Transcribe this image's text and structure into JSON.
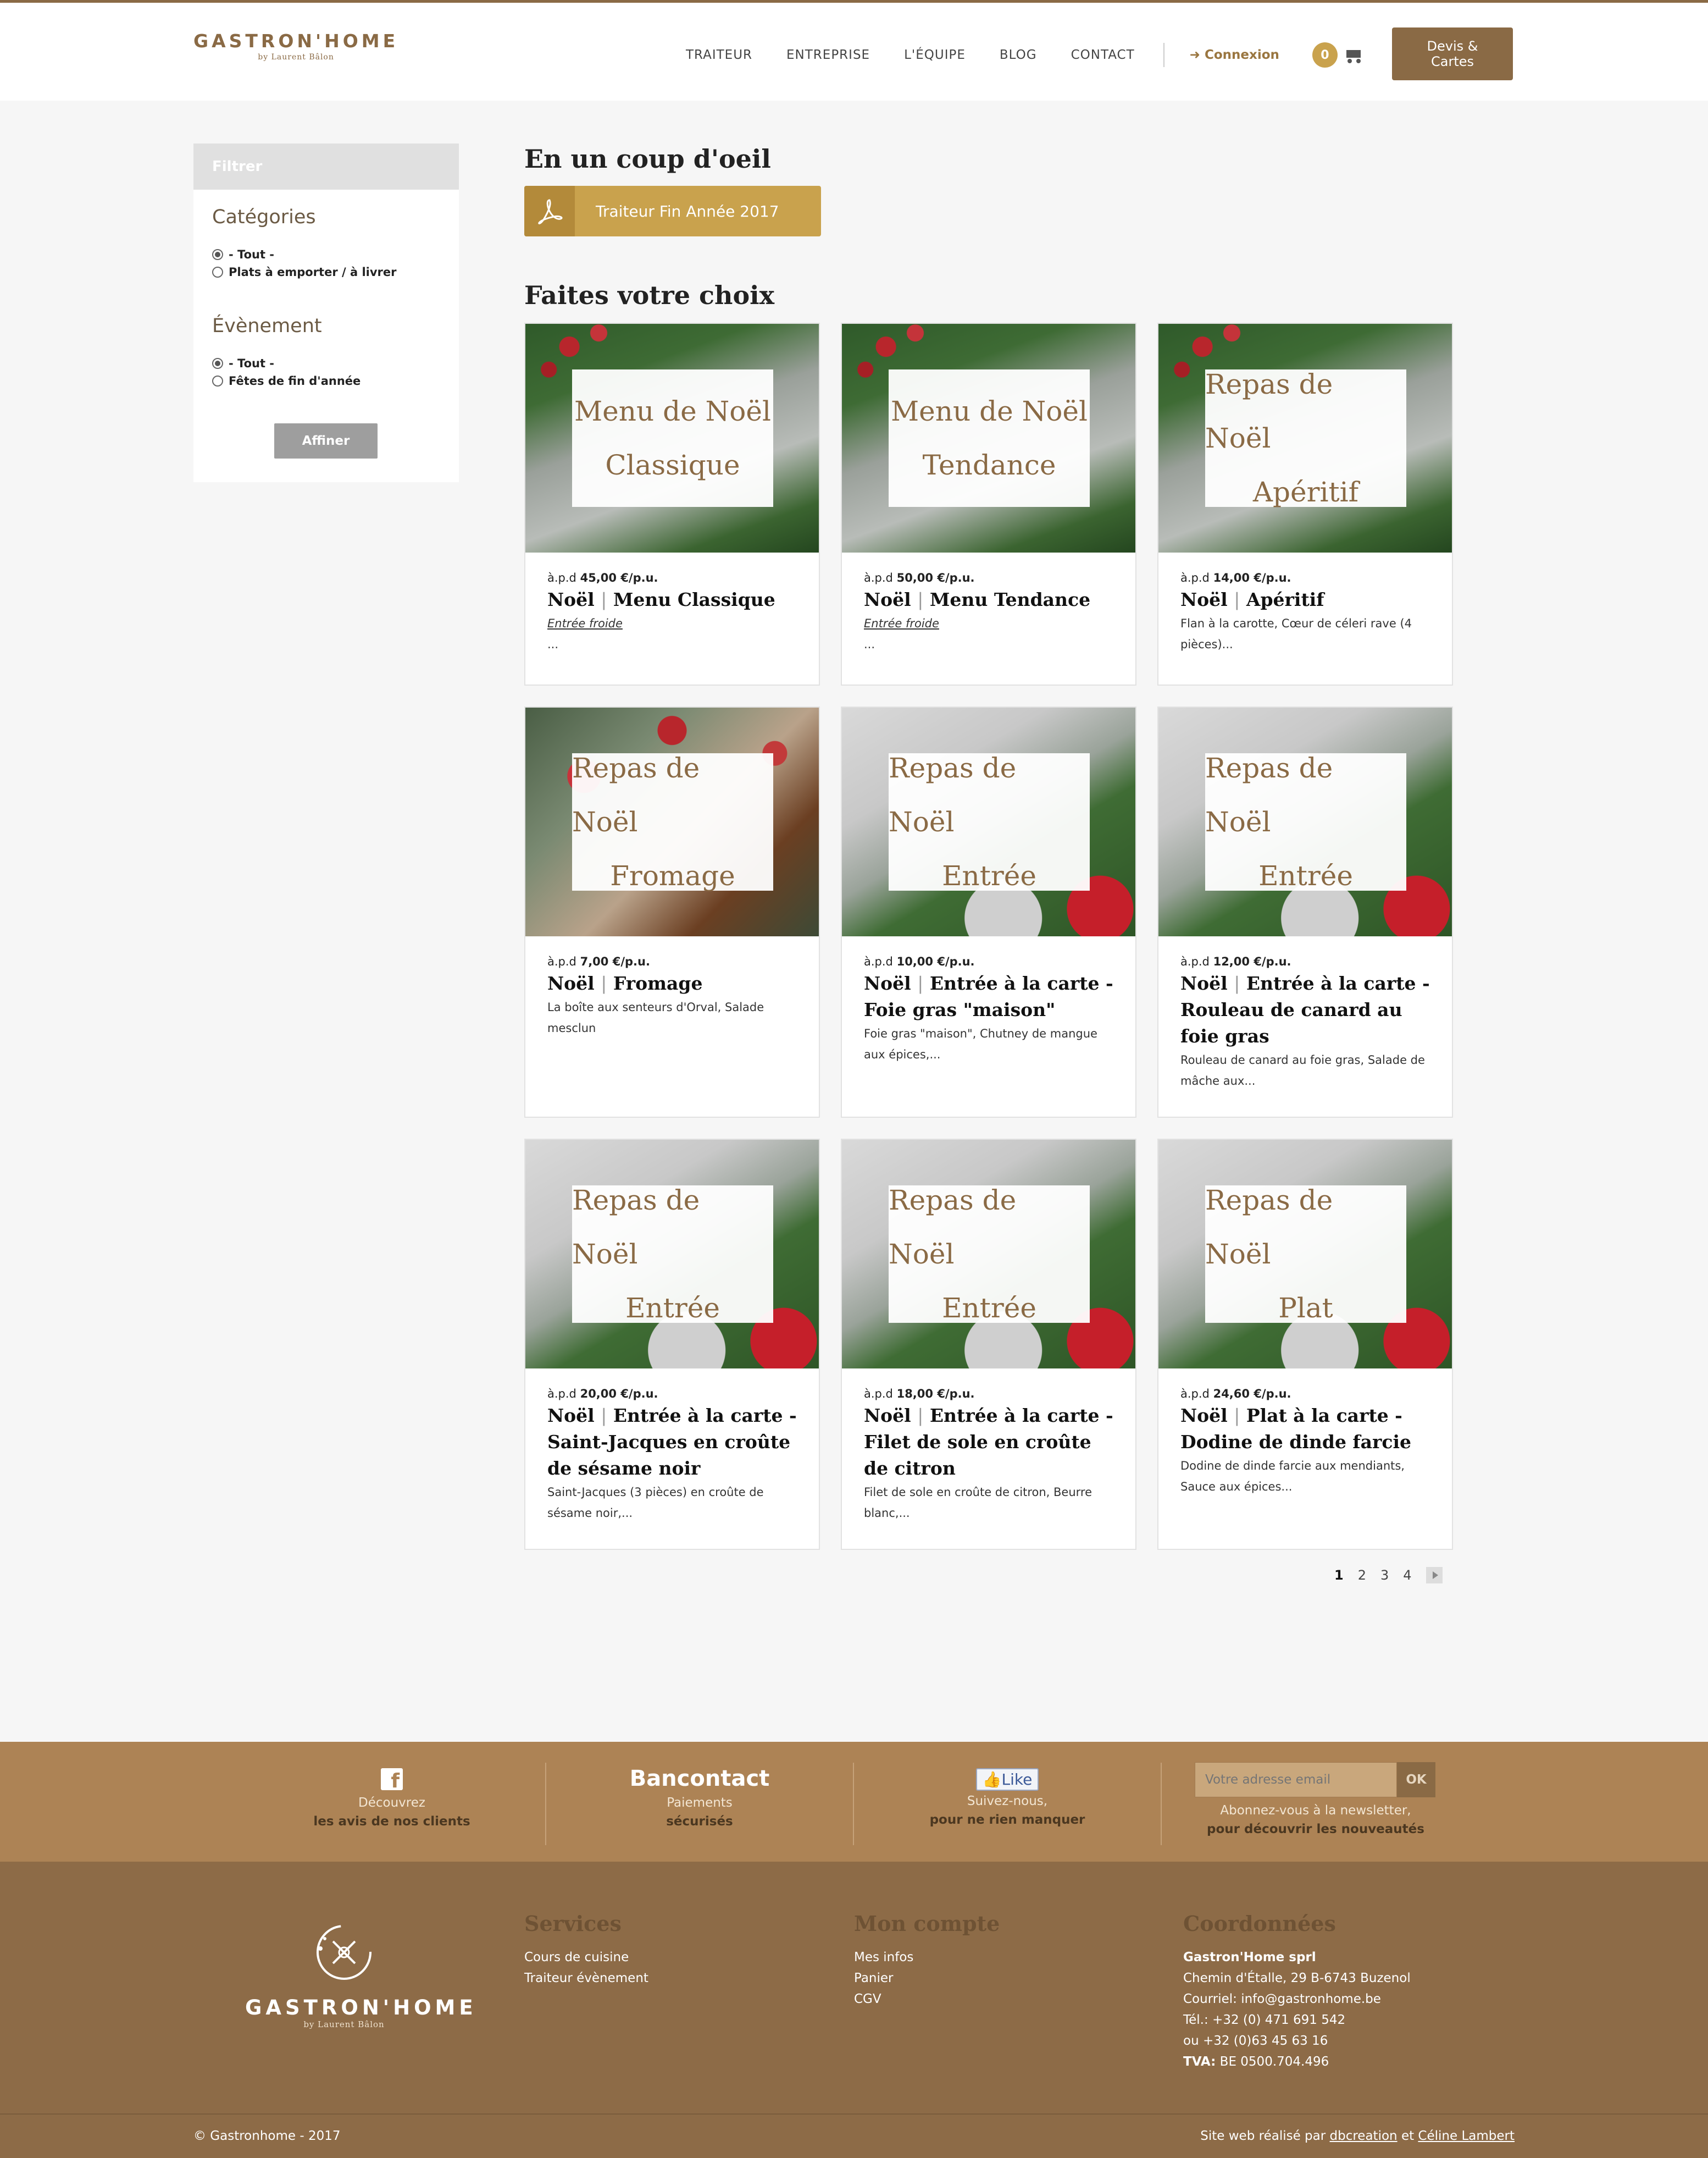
{
  "header": {
    "brand": "GASTRON'HOME",
    "brand_sub": "by Laurent Bâlon",
    "nav": [
      "TRAITEUR",
      "ENTREPRISE",
      "L'ÉQUIPE",
      "BLOG",
      "CONTACT"
    ],
    "login": "Connexion",
    "cart_count": "0",
    "devis_line1": "Devis &",
    "devis_line2": "Cartes"
  },
  "sidebar": {
    "filter_title": "Filtrer",
    "categories_title": "Catégories",
    "categories": [
      {
        "label": "- Tout -",
        "checked": true
      },
      {
        "label": "Plats à emporter / à livrer",
        "checked": false
      }
    ],
    "event_title": "Évènement",
    "events": [
      {
        "label": "- Tout -",
        "checked": true
      },
      {
        "label": "Fêtes de fin d'année",
        "checked": false
      }
    ],
    "refine_label": "Affiner"
  },
  "main": {
    "glance_title": "En un coup d'oeil",
    "pdf_label": "Traiteur Fin Année 2017",
    "choice_title": "Faites votre choix",
    "products": [
      {
        "img1": "Menu de Noël",
        "img2": "Classique",
        "price_prefix": "à.p.d",
        "price": "45,00 €/p.u.",
        "cat": "Noël",
        "name": "Menu Classique",
        "desc": "Entrée froide",
        "desc2": "...",
        "style": "a"
      },
      {
        "img1": "Menu de Noël",
        "img2": "Tendance",
        "price_prefix": "à.p.d",
        "price": "50,00 €/p.u.",
        "cat": "Noël",
        "name": "Menu Tendance",
        "desc": "Entrée froide",
        "desc2": "...",
        "style": "a"
      },
      {
        "img1": "Repas de Noël",
        "img2": "Apéritif",
        "price_prefix": "à.p.d",
        "price": "14,00 €/p.u.",
        "cat": "Noël",
        "name": "Apéritif",
        "desc": "Flan à la carotte, Cœur de céleri rave (4 pièces)...",
        "desc2": "",
        "style": "a"
      },
      {
        "img1": "Repas de Noël",
        "img2": "Fromage",
        "price_prefix": "à.p.d",
        "price": "7,00 €/p.u.",
        "cat": "Noël",
        "name": "Fromage",
        "desc": "La boîte aux senteurs d'Orval, Salade mesclun",
        "desc2": "",
        "style": "b"
      },
      {
        "img1": "Repas de Noël",
        "img2": "Entrée",
        "price_prefix": "à.p.d",
        "price": "10,00 €/p.u.",
        "cat": "Noël",
        "name": "Entrée à la carte - Foie gras \"maison\"",
        "desc": "Foie gras \"maison\", Chutney de mangue aux épices,...",
        "desc2": "",
        "style": "c"
      },
      {
        "img1": "Repas de Noël",
        "img2": "Entrée",
        "price_prefix": "à.p.d",
        "price": "12,00 €/p.u.",
        "cat": "Noël",
        "name": "Entrée à la carte - Rouleau de canard au foie gras",
        "desc": "Rouleau de canard au foie gras, Salade de mâche aux...",
        "desc2": "",
        "style": "c"
      },
      {
        "img1": "Repas de Noël",
        "img2": "Entrée",
        "price_prefix": "à.p.d",
        "price": "20,00 €/p.u.",
        "cat": "Noël",
        "name": "Entrée à la carte - Saint-Jacques en croûte de sésame noir",
        "desc": "Saint-Jacques (3 pièces) en croûte de sésame noir,...",
        "desc2": "",
        "style": "c"
      },
      {
        "img1": "Repas de Noël",
        "img2": "Entrée",
        "price_prefix": "à.p.d",
        "price": "18,00 €/p.u.",
        "cat": "Noël",
        "name": "Entrée à la carte - Filet de sole en croûte de citron",
        "desc": "Filet de sole en croûte de citron, Beurre blanc,...",
        "desc2": "",
        "style": "c"
      },
      {
        "img1": "Repas de Noël",
        "img2": "Plat",
        "price_prefix": "à.p.d",
        "price": "24,60 €/p.u.",
        "cat": "Noël",
        "name": "Plat à la carte - Dodine de dinde farcie",
        "desc": "Dodine de dinde farcie aux mendiants, Sauce aux épices...",
        "desc2": "",
        "style": "c"
      }
    ],
    "pagination": [
      "1",
      "2",
      "3",
      "4"
    ]
  },
  "footer": {
    "fb_line1": "Découvrez",
    "fb_line2": "les avis de nos clients",
    "bancontact": "Bancontact",
    "pay_line1": "Paiements",
    "pay_line2": "sécurisés",
    "like": "Like",
    "follow_line1": "Suivez-nous,",
    "follow_line2": "pour ne rien manquer",
    "email_placeholder": "Votre adresse email",
    "ok": "OK",
    "news_line1": "Abonnez-vous à la newsletter,",
    "news_line2": "pour découvrir les nouveautés",
    "services_title": "Services",
    "services": [
      "Cours de cuisine",
      "Traiteur évènement"
    ],
    "account_title": "Mon compte",
    "account": [
      "Mes infos",
      "Panier",
      "CGV"
    ],
    "contact_title": "Coordonnées",
    "company": "Gastron'Home sprl",
    "address": "Chemin d'Étalle, 29 B-6743 Buzenol",
    "email": "Courriel: info@gastronhome.be",
    "tel1": "Tél.: +32 (0) 471 691 542",
    "tel2": "ou +32 (0)63 45 63 16",
    "tva_label": "TVA:",
    "tva": "BE 0500.704.496",
    "copyright": "© Gastronhome - 2017",
    "credit_prefix": "Site web réalisé par",
    "credit_a": "dbcreation",
    "credit_mid": "et",
    "credit_b": "Céline Lambert"
  }
}
